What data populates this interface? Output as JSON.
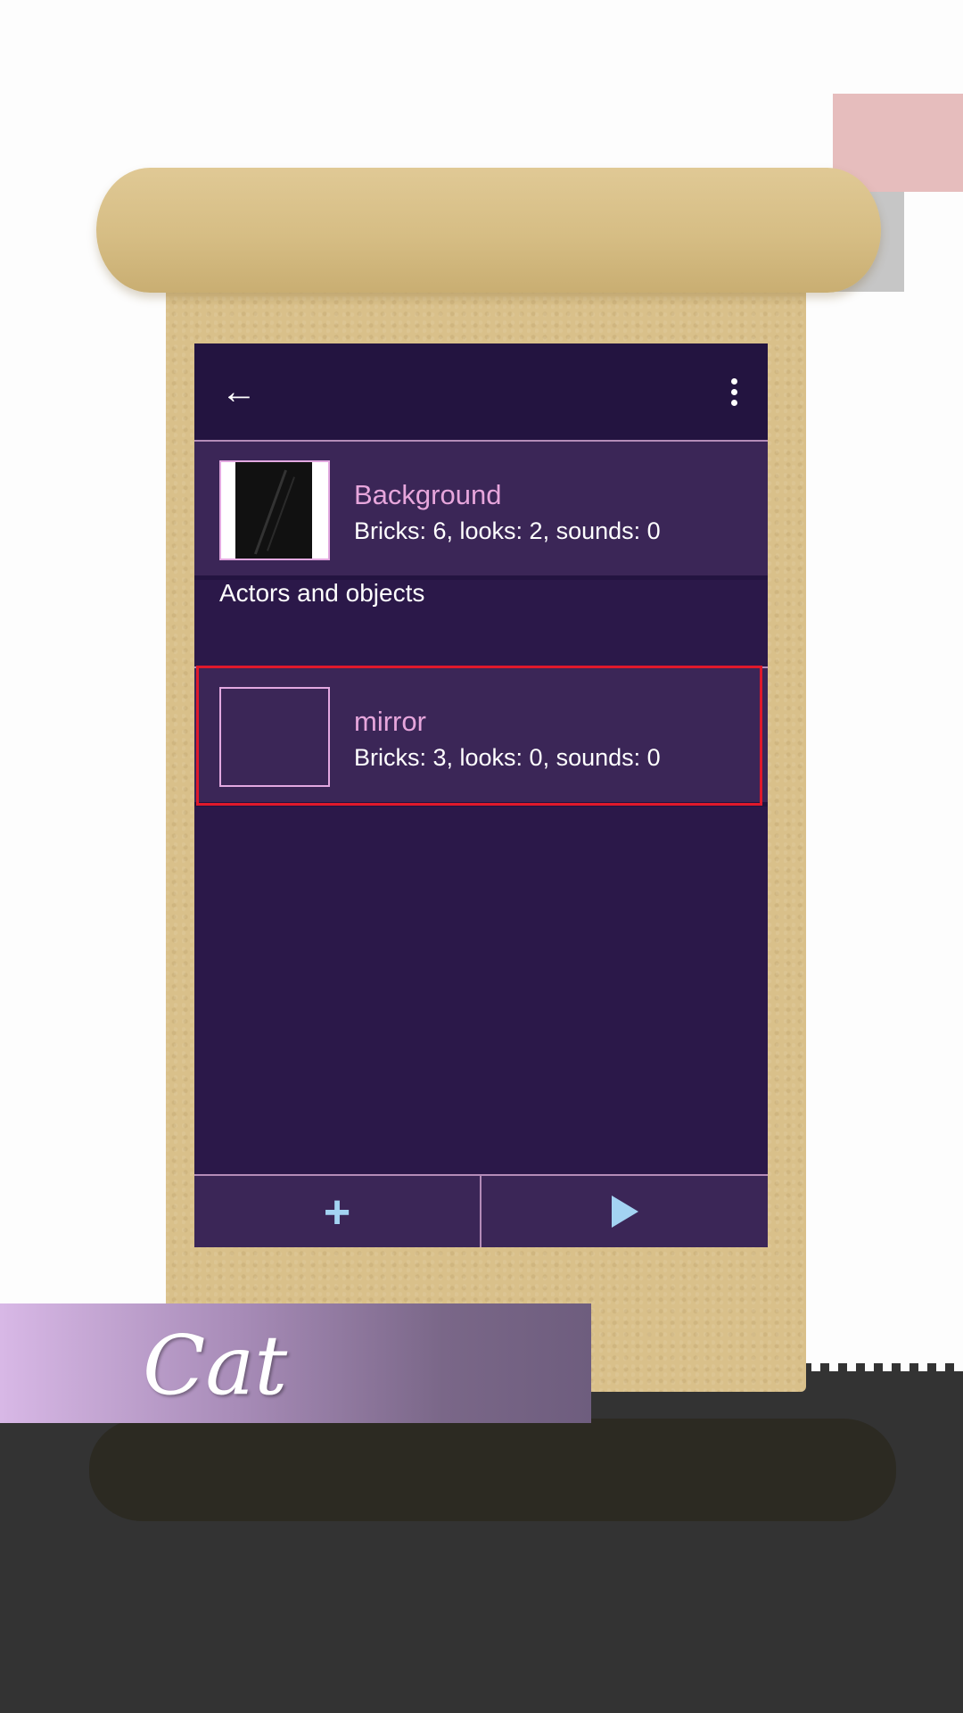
{
  "toolbar": {
    "back_icon": "arrow-left-icon",
    "title": "",
    "menu_icon": "more-vertical-icon"
  },
  "background_item": {
    "name": "Background",
    "details": "Bricks: 6, looks: 2, sounds: 0"
  },
  "section": {
    "header": "Actors and objects"
  },
  "actors": [
    {
      "name": "mirror",
      "details": "Bricks: 3, looks: 0, sounds: 0"
    }
  ],
  "bottom_bar": {
    "add_icon": "plus-icon",
    "play_icon": "play-icon",
    "add_label": "+"
  },
  "banner": {
    "text": "Cat"
  },
  "colors": {
    "app_background": "#2b1849",
    "toolbar": "#231440",
    "list_item": "#3b2657",
    "accent_pink": "#e7a6dc",
    "accent_blue": "#a3d3f2",
    "highlight_red": "#e0192b"
  }
}
